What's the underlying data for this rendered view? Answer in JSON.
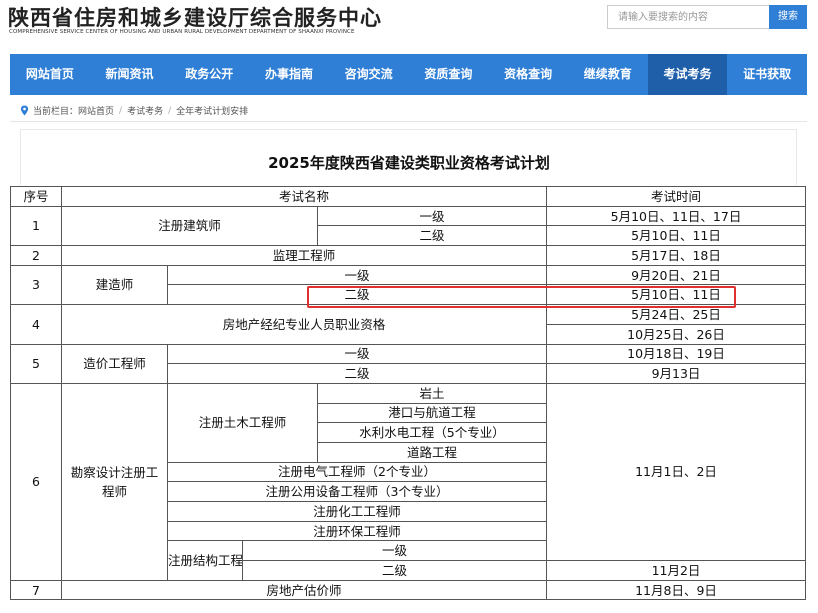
{
  "header": {
    "title": "陕西省住房和城乡建设厅综合服务中心",
    "subtitle": "COMPREHENSIVE SERVICE CENTER OF HOUSING AND URBAN RURAL DEVELOPMENT DEPARTMENT OF SHAANXI PROVINCE",
    "search_placeholder": "请输入要搜索的内容",
    "search_button": "搜索"
  },
  "nav": {
    "items": [
      "网站首页",
      "新闻资讯",
      "政务公开",
      "办事指南",
      "咨询交流",
      "资质查询",
      "资格查询",
      "继续教育",
      "考试考务",
      "证书获取"
    ],
    "active_index": 8
  },
  "breadcrumb": {
    "label": "当前栏目：",
    "items": [
      "网站首页",
      "考试考务",
      "全年考试计划安排"
    ]
  },
  "page_title": "2025年度陕西省建设类职业资格考试计划",
  "table": {
    "headers": {
      "seq": "序号",
      "name": "考试名称",
      "time": "考试时间"
    },
    "rows": {
      "r1": {
        "seq": "1",
        "name": "注册建筑师",
        "l1": "一级",
        "t1": "5月10日、11日、17日",
        "l2": "二级",
        "t2": "5月10日、11日"
      },
      "r2": {
        "seq": "2",
        "name": "监理工程师",
        "time": "5月17日、18日"
      },
      "r3": {
        "seq": "3",
        "name": "建造师",
        "l1": "一级",
        "t1": "9月20日、21日",
        "l2": "二级",
        "t2": "5月10日、11日"
      },
      "r4": {
        "seq": "4",
        "name": "房地产经纪专业人员职业资格",
        "time_line1": "5月24日、25日",
        "time_line2": "10月25日、26日"
      },
      "r5": {
        "seq": "5",
        "name": "造价工程师",
        "l1": "一级",
        "t1": "10月18日、19日",
        "l2": "二级",
        "t2": "9月13日"
      },
      "r6": {
        "seq": "6",
        "name": "勘察设计注册工程师",
        "civil": "注册土木工程师",
        "civil_subs": [
          "岩土",
          "港口与航道工程",
          "水利水电工程（5个专业）",
          "道路工程"
        ],
        "electrical": "注册电气工程师（2个专业）",
        "utilities": "注册公用设备工程师（3个专业）",
        "chemical": "注册化工工程师",
        "environmental": "注册环保工程师",
        "structural": "注册结构工程师",
        "struct_l1": "一级",
        "struct_l2": "二级",
        "time": "11月1日、2日",
        "time_struct_l2": "11月2日"
      },
      "r7": {
        "seq": "7",
        "name": "房地产估价师",
        "time": "11月8日、9日"
      }
    }
  },
  "colors": {
    "nav_bg": "#2f7fd6",
    "nav_active": "#1f5ea9",
    "highlight": "#e03030"
  }
}
